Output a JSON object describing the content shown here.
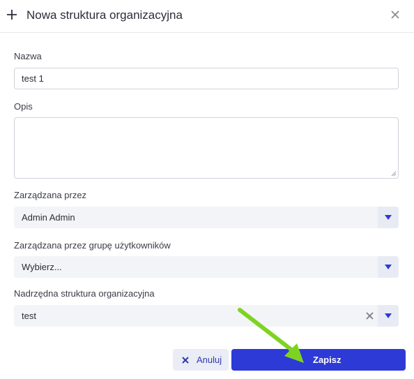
{
  "header": {
    "title": "Nowa struktura organizacyjna",
    "icon": "plus-icon",
    "close_icon": "close-icon"
  },
  "form": {
    "name": {
      "label": "Nazwa",
      "value": "test 1"
    },
    "description": {
      "label": "Opis",
      "value": ""
    },
    "managed_by": {
      "label": "Zarządzana przez",
      "value": "Admin Admin"
    },
    "managed_by_group": {
      "label": "Zarządzana przez grupę użytkowników",
      "value": "Wybierz..."
    },
    "parent_structure": {
      "label": "Nadrzędna struktura organizacyjna",
      "value": "test"
    }
  },
  "actions": {
    "cancel_label": "Anuluj",
    "save_label": "Zapisz"
  },
  "colors": {
    "primary": "#2e3ad6",
    "cancel_bg": "#eaecf6",
    "select_bg": "#f3f4f7",
    "annotation_arrow": "#7ed321"
  }
}
